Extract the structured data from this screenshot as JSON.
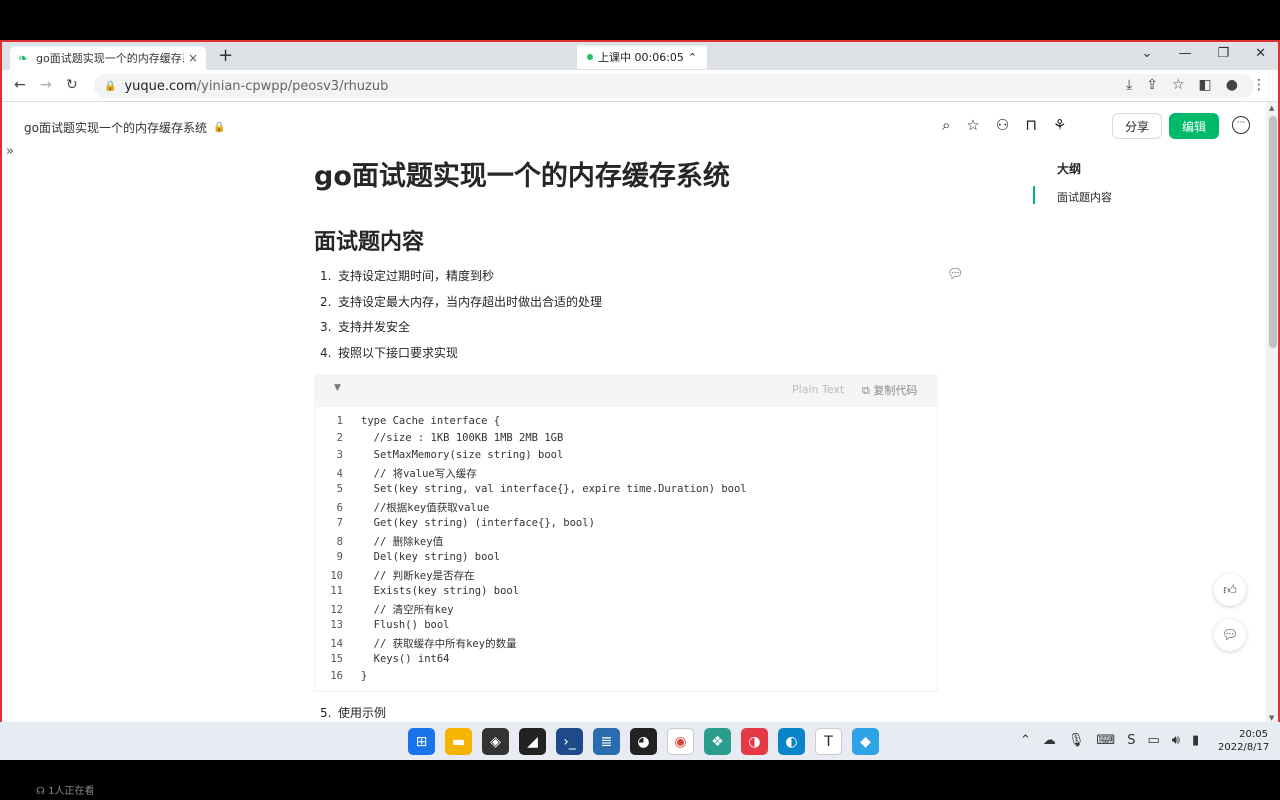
{
  "browser": {
    "tab_title": "go面试题实现一个的内存缓存系",
    "tab_close": "×",
    "new_tab": "+",
    "recording_label": "上课中 00:06:05",
    "url_host": "yuque.com",
    "url_path": "/yinian-cpwpp/peosv3/rhuzub"
  },
  "header": {
    "breadcrumb": "go面试题实现一个的内存缓存系统",
    "share_label": "分享",
    "edit_label": "编辑"
  },
  "document": {
    "title": "go面试题实现一个的内存缓存系统",
    "section_title": "面试题内容",
    "list": [
      {
        "num": "1.",
        "text": "支持设定过期时间，精度到秒"
      },
      {
        "num": "2.",
        "text": "支持设定最大内存，当内存超出时做出合适的处理"
      },
      {
        "num": "3.",
        "text": "支持并发安全"
      },
      {
        "num": "4.",
        "text": "按照以下接口要求实现"
      }
    ],
    "item5": {
      "num": "5.",
      "text": "使用示例"
    }
  },
  "code_block": {
    "language": "Plain Text",
    "copy_label": "复制代码",
    "lines": [
      {
        "n": "1",
        "t": "type Cache interface {"
      },
      {
        "n": "2",
        "t": "  //size : 1KB 100KB 1MB 2MB 1GB"
      },
      {
        "n": "3",
        "t": "  SetMaxMemory(size string) bool"
      },
      {
        "n": "4",
        "t": "  // 将value写入缓存"
      },
      {
        "n": "5",
        "t": "  Set(key string, val interface{}, expire time.Duration) bool"
      },
      {
        "n": "6",
        "t": "  //根据key值获取value"
      },
      {
        "n": "7",
        "t": "  Get(key string) (interface{}, bool)"
      },
      {
        "n": "8",
        "t": "  // 删除key值"
      },
      {
        "n": "9",
        "t": "  Del(key string) bool"
      },
      {
        "n": "10",
        "t": "  // 判断key是否存在"
      },
      {
        "n": "11",
        "t": "  Exists(key string) bool"
      },
      {
        "n": "12",
        "t": "  // 清空所有key"
      },
      {
        "n": "13",
        "t": "  Flush() bool"
      },
      {
        "n": "14",
        "t": "  // 获取缓存中所有key的数量"
      },
      {
        "n": "15",
        "t": "  Keys() int64"
      },
      {
        "n": "16",
        "t": "}"
      }
    ]
  },
  "outline": {
    "title": "大纲",
    "items": [
      "面试题内容"
    ]
  },
  "taskbar": {
    "time": "20:05",
    "date": "2022/8/17"
  },
  "viewers_label": "1人正在看",
  "colors": {
    "accent": "#00b96b",
    "frame_border": "#e03030"
  }
}
